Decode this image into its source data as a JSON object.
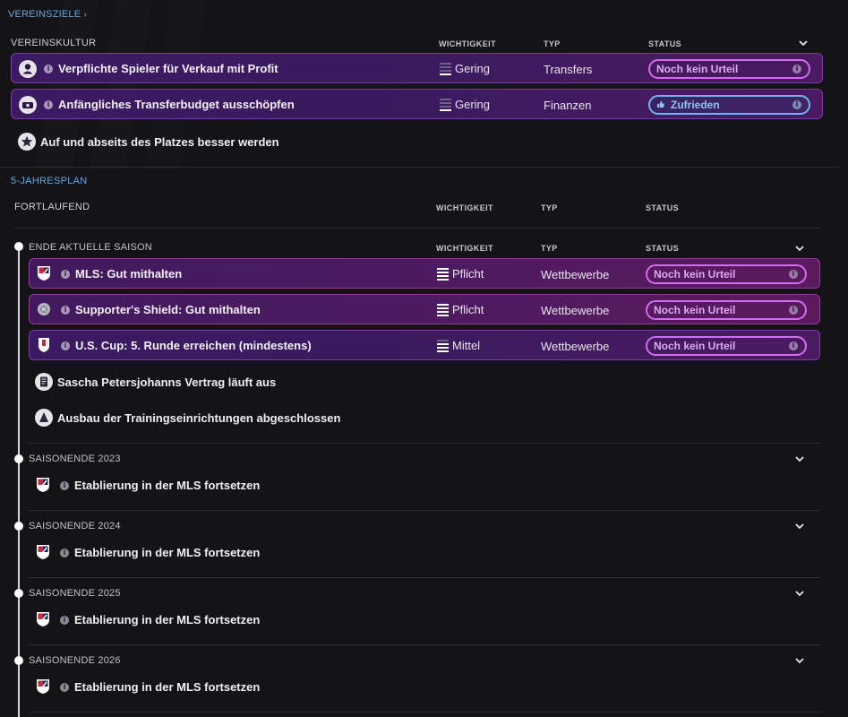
{
  "header_link": "VEREINSZIELE",
  "vereinskultur": {
    "label": "VEREINSKULTUR",
    "col_importance": "WICHTIGKEIT",
    "col_type": "TYP",
    "col_status": "STATUS",
    "rows": [
      {
        "title": "Verpflichte Spieler für Verkauf mit Profit",
        "importance": "Gering",
        "type": "Transfers",
        "status": "Noch kein Urteil",
        "icon": "person-icon"
      },
      {
        "title": "Anfängliches Transferbudget ausschöpfen",
        "importance": "Gering",
        "type": "Finanzen",
        "status": "Zufrieden",
        "icon": "money-icon"
      }
    ],
    "extra": "Auf und abseits des Platzes besser werden"
  },
  "plan": {
    "label": "5-JAHRESPLAN",
    "ongoing": {
      "label": "FORTLAUFEND",
      "col_importance": "WICHTIGKEIT",
      "col_type": "TYP",
      "col_status": "STATUS"
    },
    "current_season": {
      "label": "ENDE AKTUELLE SAISON",
      "col_importance": "WICHTIGKEIT",
      "col_type": "TYP",
      "col_status": "STATUS",
      "rows": [
        {
          "title": "MLS: Gut mithalten",
          "importance": "Pflicht",
          "type": "Wettbewerbe",
          "status": "Noch kein Urteil",
          "icon": "mls-crest-icon"
        },
        {
          "title": "Supporter's Shield: Gut mithalten",
          "importance": "Pflicht",
          "type": "Wettbewerbe",
          "status": "Noch kein Urteil",
          "icon": "shield-trophy-icon"
        },
        {
          "title": "U.S. Cup: 5. Runde erreichen (mindestens)",
          "importance": "Mittel",
          "type": "Wettbewerbe",
          "status": "Noch kein Urteil",
          "icon": "cup-crest-icon"
        }
      ],
      "events": [
        {
          "text": "Sascha Petersjohanns Vertrag läuft aus",
          "icon": "contract-icon"
        },
        {
          "text": "Ausbau der Trainingseinrichtungen abgeschlossen",
          "icon": "training-cone-icon"
        }
      ]
    },
    "seasons": [
      {
        "label": "SAISONENDE 2023",
        "goal": "Etablierung in der MLS fortsetzen"
      },
      {
        "label": "SAISONENDE 2024",
        "goal": "Etablierung in der MLS fortsetzen"
      },
      {
        "label": "SAISONENDE 2025",
        "goal": "Etablierung in der MLS fortsetzen"
      },
      {
        "label": "SAISONENDE 2026",
        "goal": "Etablierung in der MLS fortsetzen"
      }
    ]
  },
  "colors": {
    "background": "#141416",
    "link": "#5fa8e8",
    "row_purple": "#3b1a62",
    "row_magenta": "#4d1a60",
    "pill_pending": "#d36cf0",
    "pill_satisfied": "#6fb4f0"
  }
}
